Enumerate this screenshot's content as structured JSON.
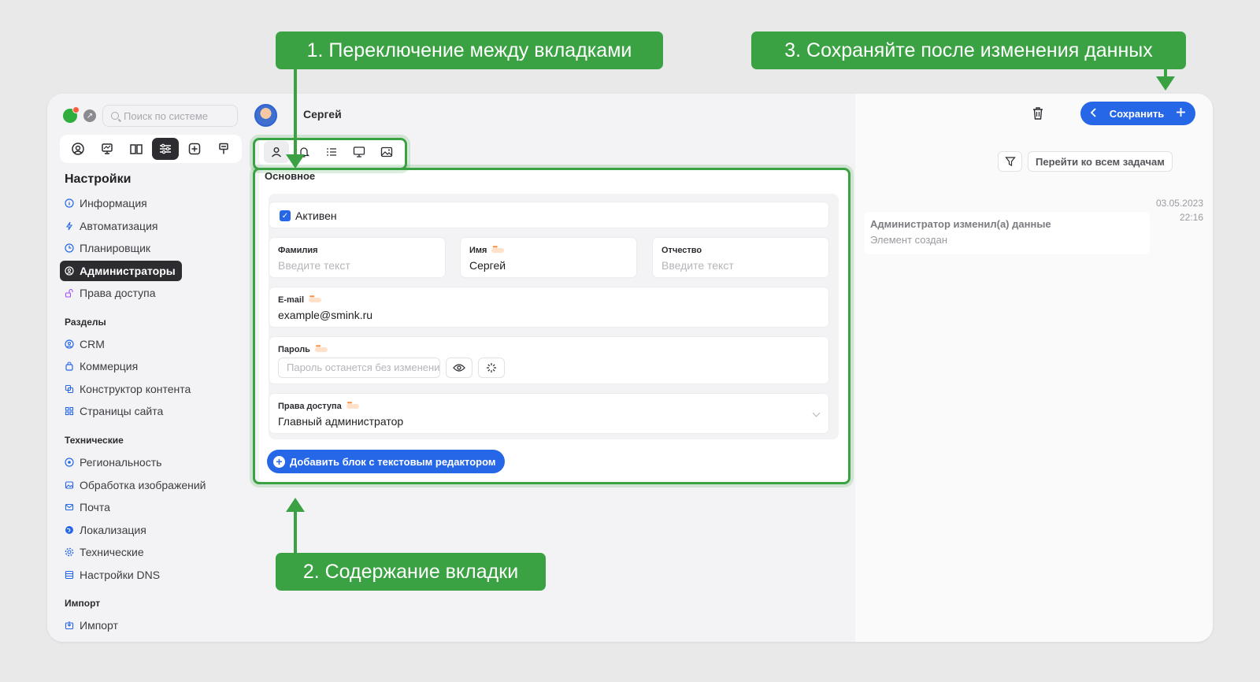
{
  "sidebar": {
    "search_placeholder": "Поиск по системе",
    "heading": "Настройки",
    "settings_items": [
      {
        "label": "Информация",
        "icon": "info-icon"
      },
      {
        "label": "Автоматизация",
        "icon": "automation-icon"
      },
      {
        "label": "Планировщик",
        "icon": "clock-icon"
      },
      {
        "label": "Администраторы",
        "icon": "admin-icon"
      },
      {
        "label": "Права доступа",
        "icon": "unlock-icon"
      }
    ],
    "sections_title": "Разделы",
    "sections_items": [
      {
        "label": "CRM",
        "icon": "crm-icon"
      },
      {
        "label": "Коммерция",
        "icon": "bag-icon"
      },
      {
        "label": "Конструктор контента",
        "icon": "constructor-icon"
      },
      {
        "label": "Страницы сайта",
        "icon": "grid-icon"
      }
    ],
    "technical_title": "Технические",
    "technical_items": [
      {
        "label": "Региональность",
        "icon": "location-icon"
      },
      {
        "label": "Обработка изображений",
        "icon": "image-icon"
      },
      {
        "label": "Почта",
        "icon": "mail-icon"
      },
      {
        "label": "Локализация",
        "icon": "globe-icon"
      },
      {
        "label": "Технические",
        "icon": "gear-icon"
      },
      {
        "label": "Настройки DNS",
        "icon": "server-icon"
      }
    ],
    "import_title": "Импорт",
    "import_items": [
      {
        "label": "Импорт",
        "icon": "import-icon"
      }
    ]
  },
  "header": {
    "username": "Сергей",
    "save_label": "Сохранить"
  },
  "form": {
    "section_title": "Основное",
    "active_label": "Активен",
    "lastname_label": "Фамилия",
    "lastname_placeholder": "Введите текст",
    "firstname_label": "Имя",
    "firstname_value": "Сергей",
    "middlename_label": "Отчество",
    "middlename_placeholder": "Введите текст",
    "email_label": "E-mail",
    "email_value": "example@smink.ru",
    "password_label": "Пароль",
    "password_placeholder": "Пароль останется без изменений",
    "access_label": "Права доступа",
    "access_value": "Главный администратор",
    "add_block_label": "Добавить блок с текстовым редактором"
  },
  "right_panel": {
    "all_tasks_label": "Перейти ко всем задачам",
    "log_date": "03.05.2023",
    "log_time": "22:16",
    "log_title": "Администратор изменил(а) данные",
    "log_subtitle": "Элемент создан"
  },
  "annotations": {
    "tabs_callout": "1. Переключение между вкладками",
    "content_callout": "2. Содержание вкладки",
    "save_callout": "3. Сохраняйте после изменения данных"
  },
  "colors": {
    "accent": "#2667e8",
    "annotation_green": "#3aa243",
    "sidebar_active": "#2c2c31"
  }
}
